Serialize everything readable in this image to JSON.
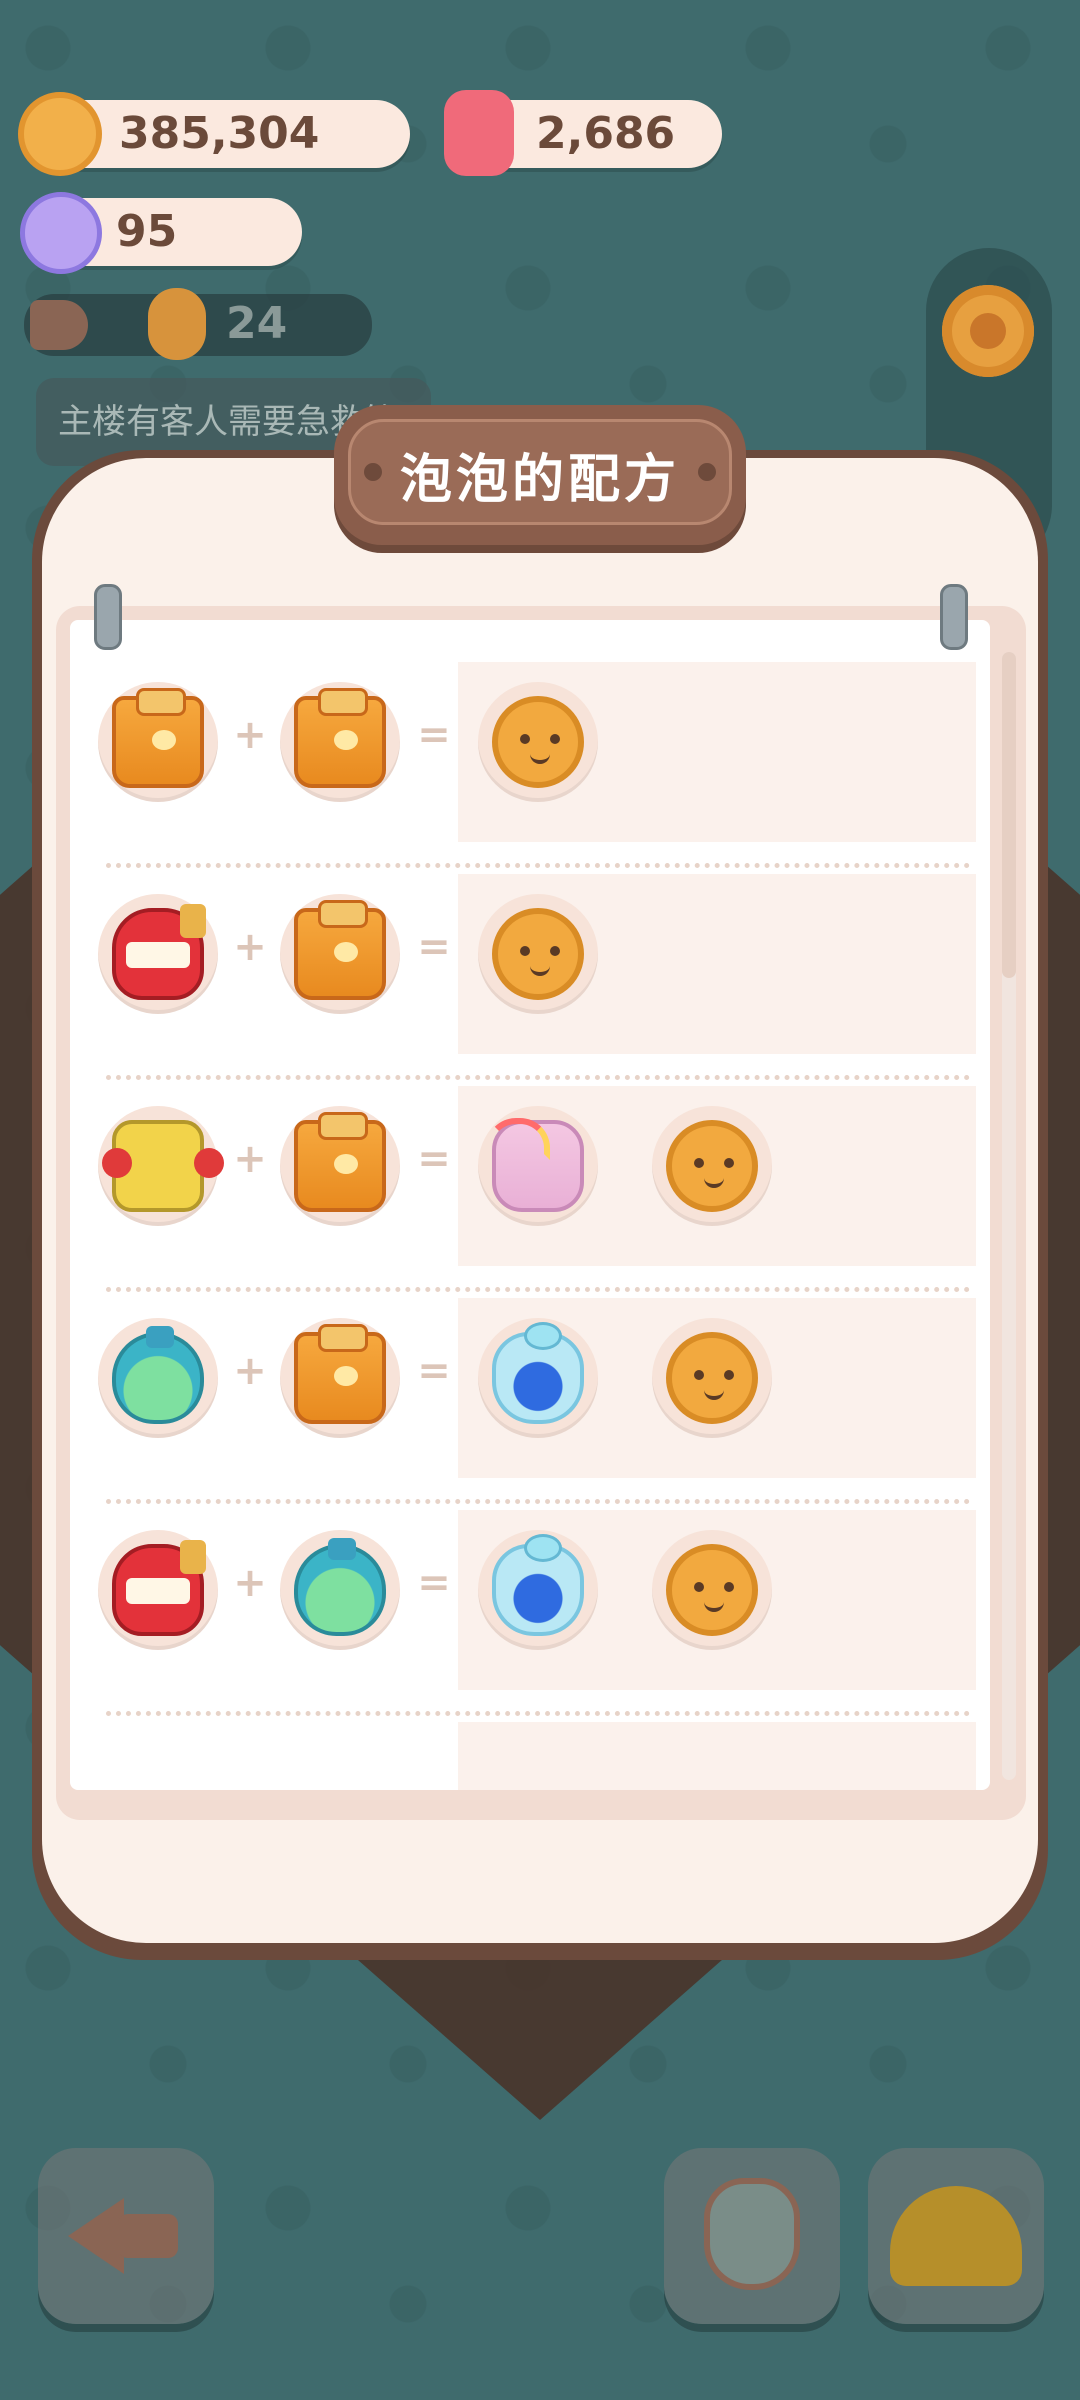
{
  "hud": {
    "coins": "385,304",
    "gems": "2,686",
    "candy": "95",
    "visitors": "24"
  },
  "notice": "主楼有客人需要急救箱",
  "modal": {
    "title": "泡泡的配方",
    "recipes": [
      {
        "a": "bag",
        "b": "bag",
        "results": [
          "cookie"
        ]
      },
      {
        "a": "teeth",
        "b": "bag",
        "results": [
          "cookie"
        ]
      },
      {
        "a": "boxer",
        "b": "bag",
        "results": [
          "bottle",
          "cookie"
        ]
      },
      {
        "a": "potion",
        "b": "bag",
        "results": [
          "pouch",
          "cookie"
        ]
      },
      {
        "a": "teeth",
        "b": "potion",
        "results": [
          "pouch",
          "cookie"
        ]
      }
    ],
    "operators": {
      "plus": "+",
      "equals": "="
    }
  },
  "icons": {
    "coin": "cookie-coin-icon",
    "gem": "gem-icon",
    "candy": "candy-icon",
    "megaphone": "megaphone-icon",
    "visitor": "visitor-icon",
    "settings": "gear-icon",
    "back": "back-arrow-icon",
    "bottle": "potion-bottle-icon",
    "helmet": "helmet-icon"
  },
  "colors": {
    "background": "#3f6b6d",
    "modal_border": "#6b4a3c",
    "paper": "#fbf1ea",
    "title_plate": "#8a5d4b"
  }
}
